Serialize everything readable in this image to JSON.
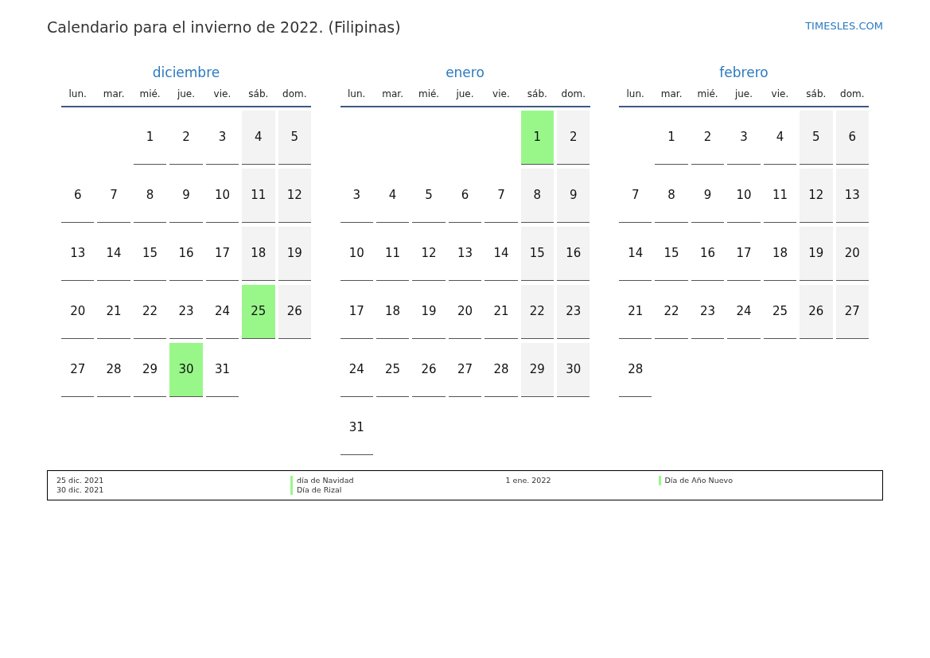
{
  "title": "Calendario para el invierno de 2022. (Filipinas)",
  "brand": "TIMESLES.COM",
  "months": [
    {
      "name": "diciembre",
      "weekdays": [
        "lun.",
        "mar.",
        "mié.",
        "jue.",
        "vie.",
        "sáb.",
        "dom."
      ],
      "weeks": [
        [
          {
            "kind": "blank"
          },
          {
            "kind": "blank"
          },
          {
            "kind": "day",
            "day": "1",
            "weekend": false,
            "holiday": false
          },
          {
            "kind": "day",
            "day": "2",
            "weekend": false,
            "holiday": false
          },
          {
            "kind": "day",
            "day": "3",
            "weekend": false,
            "holiday": false
          },
          {
            "kind": "day",
            "day": "4",
            "weekend": true,
            "holiday": false
          },
          {
            "kind": "day",
            "day": "5",
            "weekend": true,
            "holiday": false
          }
        ],
        [
          {
            "kind": "day",
            "day": "6",
            "weekend": false,
            "holiday": false
          },
          {
            "kind": "day",
            "day": "7",
            "weekend": false,
            "holiday": false
          },
          {
            "kind": "day",
            "day": "8",
            "weekend": false,
            "holiday": false
          },
          {
            "kind": "day",
            "day": "9",
            "weekend": false,
            "holiday": false
          },
          {
            "kind": "day",
            "day": "10",
            "weekend": false,
            "holiday": false
          },
          {
            "kind": "day",
            "day": "11",
            "weekend": true,
            "holiday": false
          },
          {
            "kind": "day",
            "day": "12",
            "weekend": true,
            "holiday": false
          }
        ],
        [
          {
            "kind": "day",
            "day": "13",
            "weekend": false,
            "holiday": false
          },
          {
            "kind": "day",
            "day": "14",
            "weekend": false,
            "holiday": false
          },
          {
            "kind": "day",
            "day": "15",
            "weekend": false,
            "holiday": false
          },
          {
            "kind": "day",
            "day": "16",
            "weekend": false,
            "holiday": false
          },
          {
            "kind": "day",
            "day": "17",
            "weekend": false,
            "holiday": false
          },
          {
            "kind": "day",
            "day": "18",
            "weekend": true,
            "holiday": false
          },
          {
            "kind": "day",
            "day": "19",
            "weekend": true,
            "holiday": false
          }
        ],
        [
          {
            "kind": "day",
            "day": "20",
            "weekend": false,
            "holiday": false
          },
          {
            "kind": "day",
            "day": "21",
            "weekend": false,
            "holiday": false
          },
          {
            "kind": "day",
            "day": "22",
            "weekend": false,
            "holiday": false
          },
          {
            "kind": "day",
            "day": "23",
            "weekend": false,
            "holiday": false
          },
          {
            "kind": "day",
            "day": "24",
            "weekend": false,
            "holiday": false
          },
          {
            "kind": "day",
            "day": "25",
            "holiday": true
          },
          {
            "kind": "day",
            "day": "26",
            "weekend": true,
            "holiday": false
          }
        ],
        [
          {
            "kind": "day",
            "day": "27",
            "weekend": false,
            "holiday": false
          },
          {
            "kind": "day",
            "day": "28",
            "weekend": false,
            "holiday": false
          },
          {
            "kind": "day",
            "day": "29",
            "weekend": false,
            "holiday": false
          },
          {
            "kind": "day",
            "day": "30",
            "holiday": true
          },
          {
            "kind": "day",
            "day": "31",
            "weekend": false,
            "holiday": false
          },
          {
            "kind": "blank"
          },
          {
            "kind": "blank"
          }
        ]
      ]
    },
    {
      "name": "enero",
      "weekdays": [
        "lun.",
        "mar.",
        "mié.",
        "jue.",
        "vie.",
        "sáb.",
        "dom."
      ],
      "weeks": [
        [
          {
            "kind": "blank"
          },
          {
            "kind": "blank"
          },
          {
            "kind": "blank"
          },
          {
            "kind": "blank"
          },
          {
            "kind": "blank"
          },
          {
            "kind": "day",
            "day": "1",
            "holiday": true
          },
          {
            "kind": "day",
            "day": "2",
            "weekend": true,
            "holiday": false
          }
        ],
        [
          {
            "kind": "day",
            "day": "3",
            "weekend": false,
            "holiday": false
          },
          {
            "kind": "day",
            "day": "4",
            "weekend": false,
            "holiday": false
          },
          {
            "kind": "day",
            "day": "5",
            "weekend": false,
            "holiday": false
          },
          {
            "kind": "day",
            "day": "6",
            "weekend": false,
            "holiday": false
          },
          {
            "kind": "day",
            "day": "7",
            "weekend": false,
            "holiday": false
          },
          {
            "kind": "day",
            "day": "8",
            "weekend": true,
            "holiday": false
          },
          {
            "kind": "day",
            "day": "9",
            "weekend": true,
            "holiday": false
          }
        ],
        [
          {
            "kind": "day",
            "day": "10",
            "weekend": false,
            "holiday": false
          },
          {
            "kind": "day",
            "day": "11",
            "weekend": false,
            "holiday": false
          },
          {
            "kind": "day",
            "day": "12",
            "weekend": false,
            "holiday": false
          },
          {
            "kind": "day",
            "day": "13",
            "weekend": false,
            "holiday": false
          },
          {
            "kind": "day",
            "day": "14",
            "weekend": false,
            "holiday": false
          },
          {
            "kind": "day",
            "day": "15",
            "weekend": true,
            "holiday": false
          },
          {
            "kind": "day",
            "day": "16",
            "weekend": true,
            "holiday": false
          }
        ],
        [
          {
            "kind": "day",
            "day": "17",
            "weekend": false,
            "holiday": false
          },
          {
            "kind": "day",
            "day": "18",
            "weekend": false,
            "holiday": false
          },
          {
            "kind": "day",
            "day": "19",
            "weekend": false,
            "holiday": false
          },
          {
            "kind": "day",
            "day": "20",
            "weekend": false,
            "holiday": false
          },
          {
            "kind": "day",
            "day": "21",
            "weekend": false,
            "holiday": false
          },
          {
            "kind": "day",
            "day": "22",
            "weekend": true,
            "holiday": false
          },
          {
            "kind": "day",
            "day": "23",
            "weekend": true,
            "holiday": false
          }
        ],
        [
          {
            "kind": "day",
            "day": "24",
            "weekend": false,
            "holiday": false
          },
          {
            "kind": "day",
            "day": "25",
            "weekend": false,
            "holiday": false
          },
          {
            "kind": "day",
            "day": "26",
            "weekend": false,
            "holiday": false
          },
          {
            "kind": "day",
            "day": "27",
            "weekend": false,
            "holiday": false
          },
          {
            "kind": "day",
            "day": "28",
            "weekend": false,
            "holiday": false
          },
          {
            "kind": "day",
            "day": "29",
            "weekend": true,
            "holiday": false
          },
          {
            "kind": "day",
            "day": "30",
            "weekend": true,
            "holiday": false
          }
        ],
        [
          {
            "kind": "day",
            "day": "31",
            "weekend": false,
            "holiday": false
          }
        ]
      ]
    },
    {
      "name": "febrero",
      "weekdays": [
        "lun.",
        "mar.",
        "mié.",
        "jue.",
        "vie.",
        "sáb.",
        "dom."
      ],
      "weeks": [
        [
          {
            "kind": "blank"
          },
          {
            "kind": "day",
            "day": "1",
            "weekend": false,
            "holiday": false
          },
          {
            "kind": "day",
            "day": "2",
            "weekend": false,
            "holiday": false
          },
          {
            "kind": "day",
            "day": "3",
            "weekend": false,
            "holiday": false
          },
          {
            "kind": "day",
            "day": "4",
            "weekend": false,
            "holiday": false
          },
          {
            "kind": "day",
            "day": "5",
            "weekend": true,
            "holiday": false
          },
          {
            "kind": "day",
            "day": "6",
            "weekend": true,
            "holiday": false
          }
        ],
        [
          {
            "kind": "day",
            "day": "7",
            "weekend": false,
            "holiday": false
          },
          {
            "kind": "day",
            "day": "8",
            "weekend": false,
            "holiday": false
          },
          {
            "kind": "day",
            "day": "9",
            "weekend": false,
            "holiday": false
          },
          {
            "kind": "day",
            "day": "10",
            "weekend": false,
            "holiday": false
          },
          {
            "kind": "day",
            "day": "11",
            "weekend": false,
            "holiday": false
          },
          {
            "kind": "day",
            "day": "12",
            "weekend": true,
            "holiday": false
          },
          {
            "kind": "day",
            "day": "13",
            "weekend": true,
            "holiday": false
          }
        ],
        [
          {
            "kind": "day",
            "day": "14",
            "weekend": false,
            "holiday": false
          },
          {
            "kind": "day",
            "day": "15",
            "weekend": false,
            "holiday": false
          },
          {
            "kind": "day",
            "day": "16",
            "weekend": false,
            "holiday": false
          },
          {
            "kind": "day",
            "day": "17",
            "weekend": false,
            "holiday": false
          },
          {
            "kind": "day",
            "day": "18",
            "weekend": false,
            "holiday": false
          },
          {
            "kind": "day",
            "day": "19",
            "weekend": true,
            "holiday": false
          },
          {
            "kind": "day",
            "day": "20",
            "weekend": true,
            "holiday": false
          }
        ],
        [
          {
            "kind": "day",
            "day": "21",
            "weekend": false,
            "holiday": false
          },
          {
            "kind": "day",
            "day": "22",
            "weekend": false,
            "holiday": false
          },
          {
            "kind": "day",
            "day": "23",
            "weekend": false,
            "holiday": false
          },
          {
            "kind": "day",
            "day": "24",
            "weekend": false,
            "holiday": false
          },
          {
            "kind": "day",
            "day": "25",
            "weekend": false,
            "holiday": false
          },
          {
            "kind": "day",
            "day": "26",
            "weekend": true,
            "holiday": false
          },
          {
            "kind": "day",
            "day": "27",
            "weekend": true,
            "holiday": false
          }
        ],
        [
          {
            "kind": "day",
            "day": "28",
            "weekend": false,
            "holiday": false
          }
        ]
      ]
    }
  ],
  "legend": [
    {
      "holidays": [
        {
          "date": "25 dic. 2021",
          "name": "día de Navidad"
        },
        {
          "date": "30 dic. 2021",
          "name": "Día de Rizal"
        }
      ]
    },
    {
      "holidays": [
        {
          "date": "1 ene. 2022",
          "name": "Día de Año Nuevo"
        }
      ]
    }
  ]
}
